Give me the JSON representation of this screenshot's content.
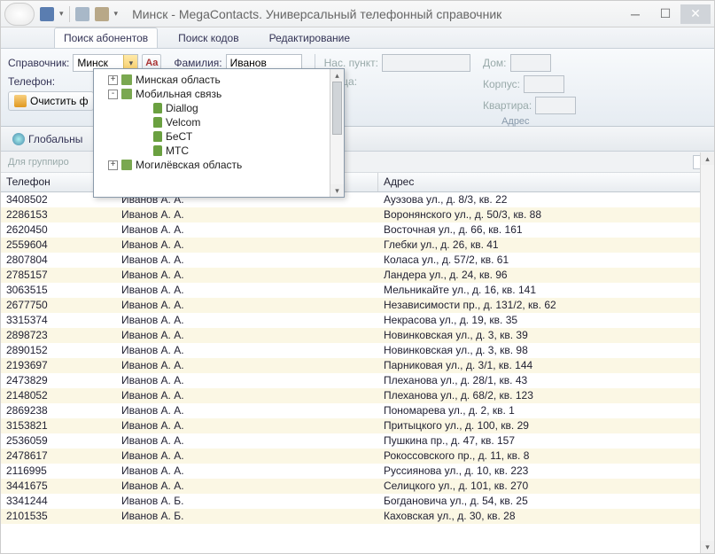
{
  "window": {
    "title": "Минск - MegaContacts. Универсальный телефонный справочник"
  },
  "tabs": [
    {
      "label": "Поиск абонентов",
      "active": true
    },
    {
      "label": "Поиск кодов",
      "active": false
    },
    {
      "label": "Редактирование",
      "active": false
    }
  ],
  "ribbon": {
    "spravochnik_label": "Справочник:",
    "spravochnik_value": "Минск",
    "telefon_label": "Телефон:",
    "aa_icon": "Aa",
    "familia_label": "Фамилия:",
    "familia_value": "Иванов",
    "clear_label": "Очистить ф",
    "address": {
      "punkt_label": "Нас. пункт:",
      "ulica_label": "Улица:",
      "dom_label": "Дом:",
      "korpus_label": "Корпус:",
      "kvartira_label": "Квартира:",
      "group_title": "Адрес"
    }
  },
  "dropdown_tree": [
    {
      "level": 1,
      "expand": "+",
      "label": "Минская область"
    },
    {
      "level": 1,
      "expand": "-",
      "label": "Мобильная связь"
    },
    {
      "level": 3,
      "expand": "",
      "label": "Diallog"
    },
    {
      "level": 3,
      "expand": "",
      "label": "Velcom"
    },
    {
      "level": 3,
      "expand": "",
      "label": "БеСТ"
    },
    {
      "level": 3,
      "expand": "",
      "label": "MTC"
    },
    {
      "level": 1,
      "expand": "+",
      "label": "Могилёвская область"
    }
  ],
  "toolbar2": {
    "global_label": "Глобальны"
  },
  "group_hint": "Для группиро",
  "columns": {
    "c1": "Телефон",
    "c2": "",
    "c3": "Адрес"
  },
  "rows": [
    {
      "phone": "3408502",
      "name": "Иванов А. А.",
      "addr": "Ауэзова ул., д. 8/3, кв. 22"
    },
    {
      "phone": "2286153",
      "name": "Иванов А. А.",
      "addr": "Воронянского ул., д. 50/3, кв. 88"
    },
    {
      "phone": "2620450",
      "name": "Иванов А. А.",
      "addr": "Восточная ул., д. 66, кв. 161"
    },
    {
      "phone": "2559604",
      "name": "Иванов А. А.",
      "addr": "Глебки ул., д. 26, кв. 41"
    },
    {
      "phone": "2807804",
      "name": "Иванов А. А.",
      "addr": "Коласа ул., д. 57/2, кв. 61"
    },
    {
      "phone": "2785157",
      "name": "Иванов А. А.",
      "addr": "Ландера ул., д. 24, кв. 96"
    },
    {
      "phone": "3063515",
      "name": "Иванов А. А.",
      "addr": "Мельникайте ул., д. 16, кв. 141"
    },
    {
      "phone": "2677750",
      "name": "Иванов А. А.",
      "addr": "Независимости пр., д. 131/2, кв. 62"
    },
    {
      "phone": "3315374",
      "name": "Иванов А. А.",
      "addr": "Некрасова ул., д. 19, кв. 35"
    },
    {
      "phone": "2898723",
      "name": "Иванов А. А.",
      "addr": "Новинковская ул., д. 3, кв. 39"
    },
    {
      "phone": "2890152",
      "name": "Иванов А. А.",
      "addr": "Новинковская ул., д. 3, кв. 98"
    },
    {
      "phone": "2193697",
      "name": "Иванов А. А.",
      "addr": "Парниковая ул., д. 3/1, кв. 144"
    },
    {
      "phone": "2473829",
      "name": "Иванов А. А.",
      "addr": "Плеханова ул., д. 28/1, кв. 43"
    },
    {
      "phone": "2148052",
      "name": "Иванов А. А.",
      "addr": "Плеханова ул., д. 68/2, кв. 123"
    },
    {
      "phone": "2869238",
      "name": "Иванов А. А.",
      "addr": "Пономарева ул., д. 2, кв. 1"
    },
    {
      "phone": "3153821",
      "name": "Иванов А. А.",
      "addr": "Притыцкого ул., д. 100, кв. 29"
    },
    {
      "phone": "2536059",
      "name": "Иванов А. А.",
      "addr": "Пушкина пр., д. 47, кв. 157"
    },
    {
      "phone": "2478617",
      "name": "Иванов А. А.",
      "addr": "Рокоссовского пр., д. 11, кв. 8"
    },
    {
      "phone": "2116995",
      "name": "Иванов А. А.",
      "addr": "Руссиянова ул., д. 10, кв. 223"
    },
    {
      "phone": "3441675",
      "name": "Иванов А. А.",
      "addr": "Селицкого ул., д. 101, кв. 270"
    },
    {
      "phone": "3341244",
      "name": "Иванов А. Б.",
      "addr": "Богдановича ул., д. 54, кв. 25"
    },
    {
      "phone": "2101535",
      "name": "Иванов А. Б.",
      "addr": "Каховская ул., д. 30, кв. 28"
    }
  ]
}
